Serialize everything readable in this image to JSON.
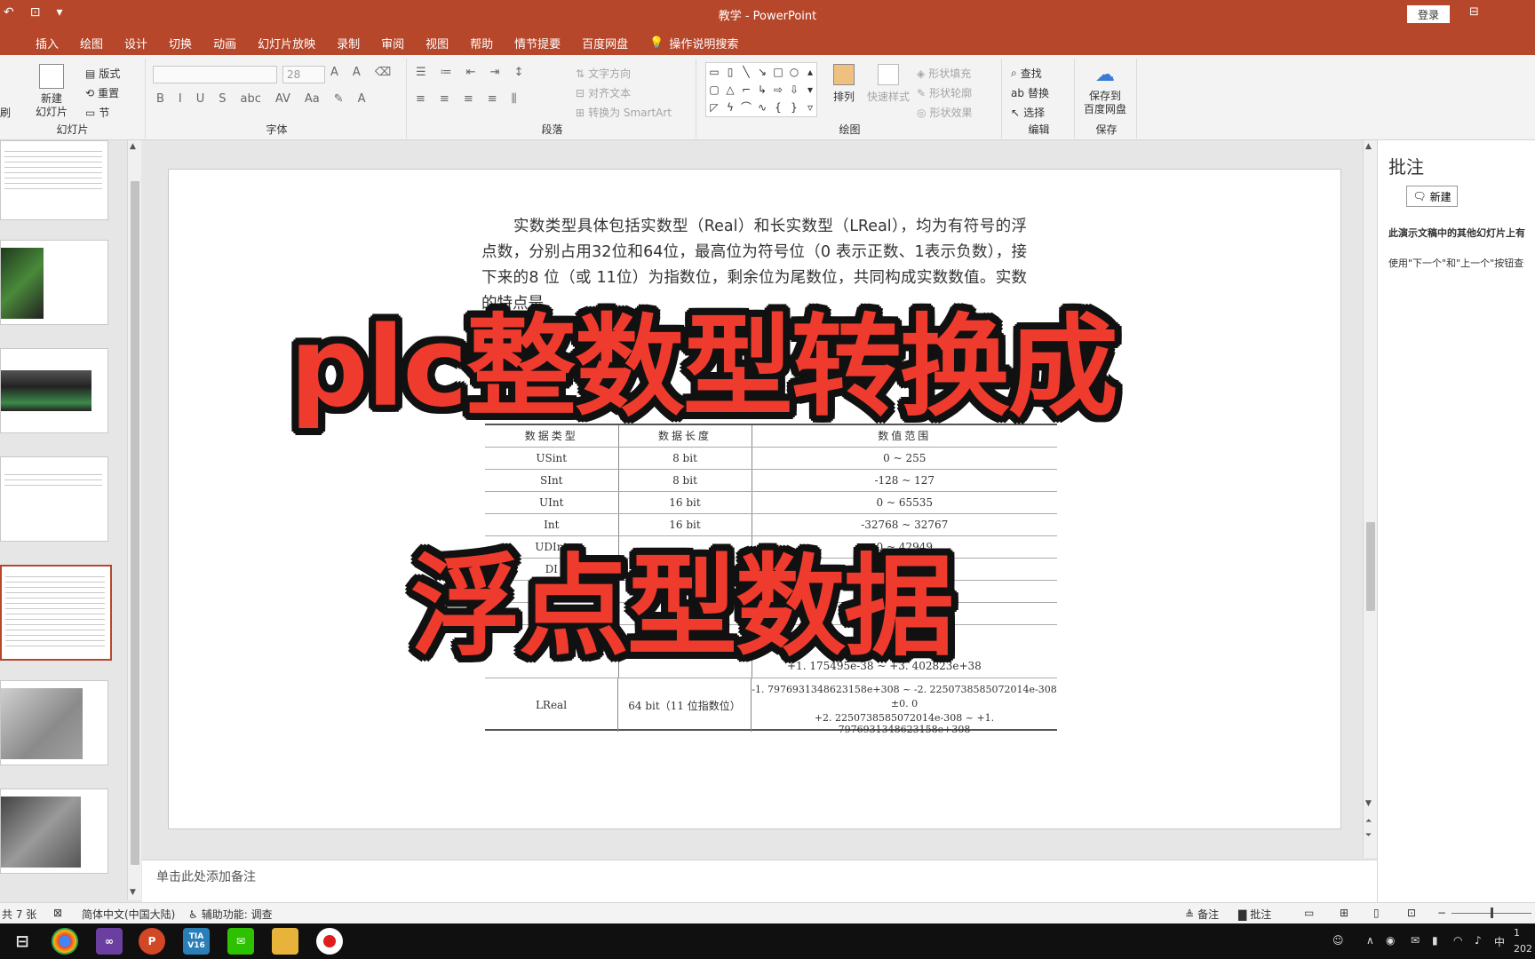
{
  "window": {
    "title": "教学  -  PowerPoint",
    "login_label": "登录"
  },
  "tabs": [
    "插入",
    "绘图",
    "设计",
    "切换",
    "动画",
    "幻灯片放映",
    "录制",
    "审阅",
    "视图",
    "帮助",
    "情节提要",
    "百度网盘"
  ],
  "tell_me": "操作说明搜索",
  "ribbon": {
    "slides_group": {
      "new_slide": "新建\n幻灯片",
      "layout": "版式",
      "reset": "重置",
      "section": "节",
      "label": "幻灯片",
      "left_fragment": "刷"
    },
    "font_group": {
      "font_size": "28",
      "label": "字体"
    },
    "paragraph_group": {
      "text_direction": "文字方向",
      "align_text": "对齐文本",
      "smartart": "转换为 SmartArt",
      "label": "段落"
    },
    "drawing_group": {
      "arrange": "排列",
      "quick_styles": "快速样式",
      "shape_fill": "形状填充",
      "shape_outline": "形状轮廓",
      "shape_effects": "形状效果",
      "label": "绘图"
    },
    "editing_group": {
      "find": "查找",
      "replace": "替换",
      "select": "选择",
      "label": "编辑"
    },
    "save_group": {
      "save_baidu": "保存到\n百度网盘",
      "label": "保存"
    }
  },
  "slide": {
    "paragraph": "实数类型具体包括实数型（Real）和长实数型（LReal），均为有符号的浮点数，分别占用32位和64位，最高位为符号位（0 表示正数、1表示负数），接下来的8 位（或 11位）为指数位，剩余位为尾数位，共同构成实数数值。实数的特点是",
    "table": {
      "headers": [
        "数据类型",
        "数据长度",
        "数值范围"
      ],
      "rows": [
        [
          "USint",
          "8 bit",
          "0 ~ 255"
        ],
        [
          "SInt",
          "8 bit",
          "-128 ~ 127"
        ],
        [
          "UInt",
          "16 bit",
          "0 ~ 65535"
        ],
        [
          "Int",
          "16 bit",
          "-32768 ~ 32767"
        ],
        [
          "UDInt",
          "",
          "0 ~ 42949"
        ],
        [
          "DI",
          "",
          ""
        ],
        [
          "UL",
          "",
          ""
        ],
        [
          "LI",
          "",
          ""
        ]
      ],
      "partial_range": "+1. 175495e-38 ~ +3. 402823e+38",
      "lreal": {
        "type": "LReal",
        "length": "64 bit（11 位指数位）",
        "range_line1": "-1. 7976931348623158e+308 ~ -2. 2250738585072014e-308",
        "range_line2": "±0. 0",
        "range_line3": "+2. 2250738585072014e-308 ~ +1. 7976931348623158e+308"
      }
    },
    "overlay_title_1": "plc整数型转换成",
    "overlay_title_2": "浮点型数据"
  },
  "notes_placeholder": "单击此处添加备注",
  "comments_pane": {
    "title": "批注",
    "new_label": "新建",
    "message_1": "此演示文稿中的其他幻灯片上有",
    "message_2": "使用\"下一个\"和\"上一个\"按钮查"
  },
  "status_bar": {
    "slide_count": "共 7 张",
    "language": "简体中文(中国大陆)",
    "accessibility": "辅助功能: 调查",
    "notes_label": "备注",
    "comments_label": "批注"
  },
  "taskbar": {
    "apps": [
      "chrome",
      "visual-studio",
      "powerpoint",
      "tia-portal",
      "wechat",
      "file-explorer",
      "recorder"
    ],
    "tia_label": "TIA\nV16",
    "ime": "中",
    "clock_time": "1",
    "clock_date": "202"
  },
  "colors": {
    "accent": "#b7472a",
    "overlay_red": "#ef3b2d"
  }
}
